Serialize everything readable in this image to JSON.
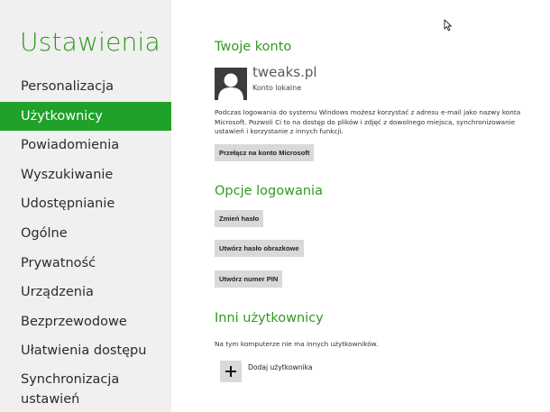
{
  "app_title": "Ustawienia",
  "nav": {
    "items": [
      {
        "label": "Personalizacja"
      },
      {
        "label": "Użytkownicy",
        "active": true
      },
      {
        "label": "Powiadomienia"
      },
      {
        "label": "Wyszukiwanie"
      },
      {
        "label": "Udostępnianie"
      },
      {
        "label": "Ogólne"
      },
      {
        "label": "Prywatność"
      },
      {
        "label": "Urządzenia"
      },
      {
        "label": "Bezprzewodowe"
      },
      {
        "label": "Ułatwienia dostępu"
      },
      {
        "label": "Synchronizacja ustawień"
      }
    ]
  },
  "account": {
    "section_title": "Twoje konto",
    "name": "tweaks.pl",
    "type": "Konto lokalne",
    "description": "Podczas logowania do systemu Windows możesz korzystać z adresu e-mail jako nazwy konta Microsoft. Pozwoli Ci to na dostęp do plików i zdjęć z dowolnego miejsca, synchronizowanie ustawień i korzystanie z innych funkcji.",
    "switch_button": "Przełącz na konto Microsoft"
  },
  "login_options": {
    "section_title": "Opcje logowania",
    "change_password": "Zmień hasło",
    "picture_password": "Utwórz hasło obrazkowe",
    "create_pin": "Utwórz numer PIN"
  },
  "other_users": {
    "section_title": "Inni użytkownicy",
    "empty_text": "Na tym komputerze nie ma innych użytkowników.",
    "add_user_label": "Dodaj użytkownika"
  },
  "colors": {
    "accent": "#2f9a1e",
    "active_nav_bg": "#1fa12a",
    "sidebar_bg": "#f0f0f0",
    "button_bg": "#d9d9d9"
  },
  "icons": {
    "avatar": "user-silhouette-icon",
    "add_user": "plus-icon",
    "cursor": "mouse-pointer-icon"
  }
}
